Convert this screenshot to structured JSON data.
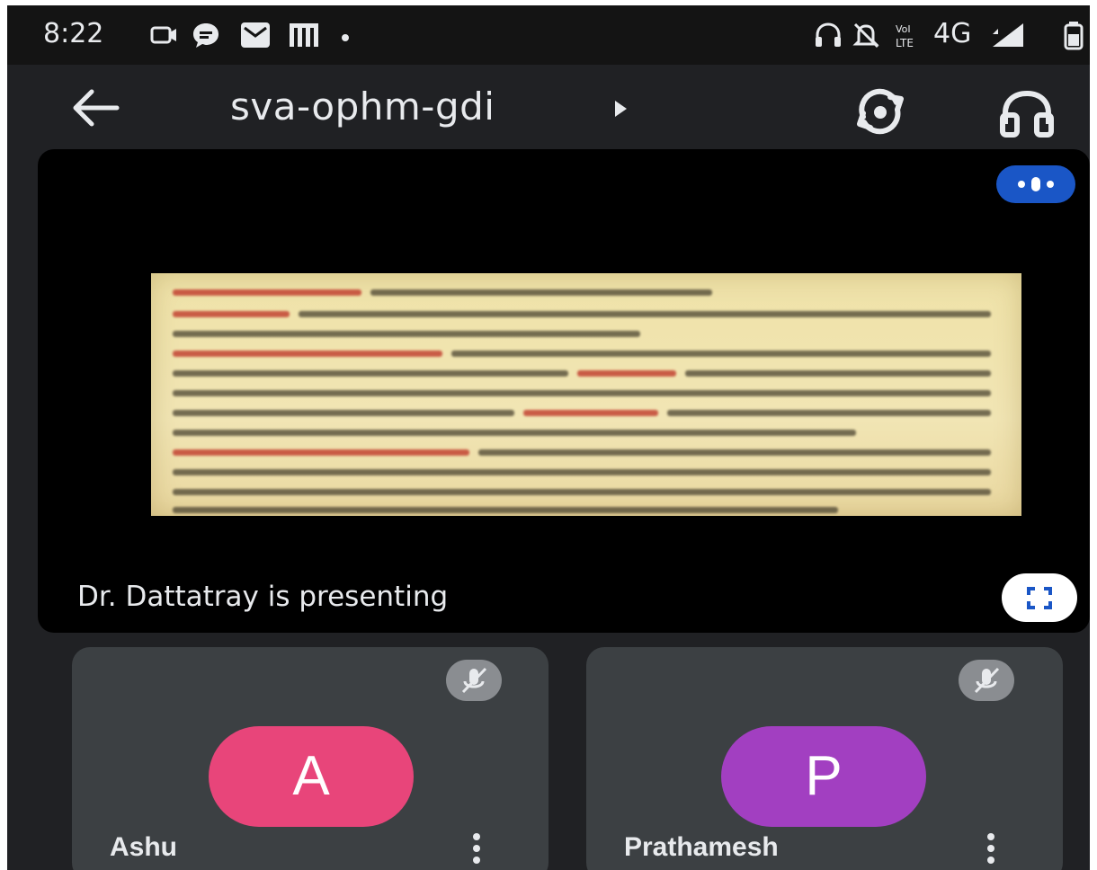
{
  "status_bar": {
    "time": "8:22",
    "network": "4G",
    "left_icons": [
      "screen-record-icon",
      "chat-bubble-icon",
      "mail-icon",
      "app-notification-icon",
      "dot-icon"
    ],
    "right_icons": [
      "headset-icon",
      "mute-notifications-icon",
      "volte-icon",
      "signal-icon",
      "battery-icon"
    ]
  },
  "app_bar": {
    "meeting_code": "sva-ophm-gdi",
    "icons": [
      "back-arrow-icon",
      "switch-camera-icon",
      "headphones-icon"
    ]
  },
  "presentation": {
    "presenter_text": "Dr. Dattatray is presenting"
  },
  "participants": [
    {
      "initial": "A",
      "name": "Ashu",
      "avatar_color": "#e8457a",
      "muted": true
    },
    {
      "initial": "P",
      "name": "Prathamesh",
      "avatar_color": "#a23fc1",
      "muted": true
    }
  ],
  "colors": {
    "background": "#202124",
    "tile": "#3c4043",
    "accent_blue": "#1a56c6"
  }
}
